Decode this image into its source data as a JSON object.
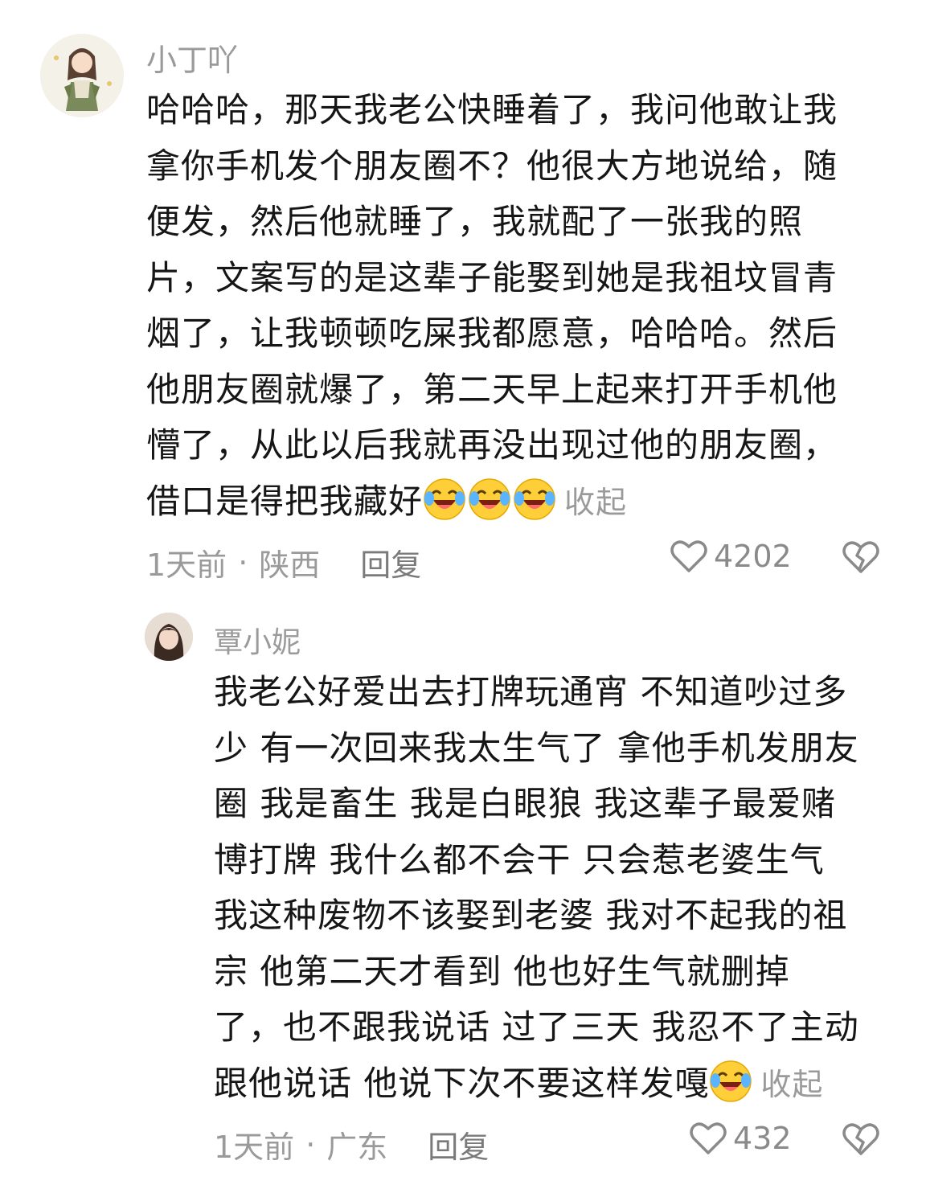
{
  "comments": [
    {
      "username": "小丁吖",
      "lines": [
        "哈哈哈，那天我老公快睡着了，我问他敢让我",
        "拿你手机发个朋友圈不？他很大方地说给，随",
        "便发，然后他就睡了，我就配了一张我的照",
        "片，文案写的是这辈子能娶到她是我祖坟冒青",
        "烟了，让我顿顿吃屎我都愿意，哈哈哈。然后",
        "他朋友圈就爆了，第二天早上起来打开手机他",
        "懵了，从此以后我就再没出现过他的朋友圈，"
      ],
      "last_line": "借口是得把我藏好",
      "emoji_icon": "laughing-crying-emoji",
      "collapse_label": "收起",
      "time": "1天前",
      "location": "陕西",
      "reply_label": "回复",
      "likes": "4202"
    },
    {
      "username": "覃小妮",
      "lines": [
        "我老公好爱出去打牌玩通宵 不知道吵过多",
        "少 有一次回来我太生气了 拿他手机发朋友",
        "圈 我是畜生 我是白眼狼 我这辈子最爱赌",
        "博打牌 我什么都不会干 只会惹老婆生气",
        "我这种废物不该娶到老婆 我对不起我的祖",
        "宗  他第二天才看到  他也好生气就删掉",
        "了，也不跟我说话 过了三天 我忍不了主动"
      ],
      "last_line": "跟他说话  他说下次不要这样发嘎",
      "emoji_icon": "laughing-crying-emoji",
      "collapse_label": "收起",
      "time": "1天前",
      "location": "广东",
      "reply_label": "回复",
      "likes": "432"
    }
  ],
  "icons": {
    "like": "heart-outline-icon",
    "dislike": "broken-heart-icon"
  }
}
